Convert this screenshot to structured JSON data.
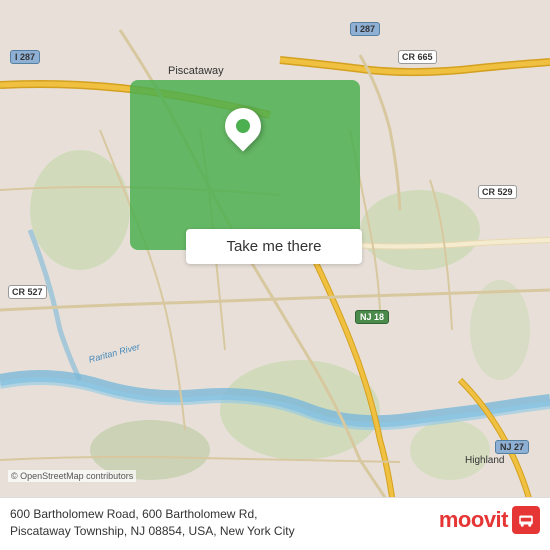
{
  "map": {
    "background_color": "#e8e0d8",
    "highlight_color": "#4CAF50"
  },
  "labels": {
    "highway_i287_top_left": "I 287",
    "highway_i287_top_right": "I 287",
    "highway_cr665": "CR 665",
    "highway_cr529": "CR 529",
    "highway_cr527": "CR 527",
    "highway_nj18": "NJ 18",
    "highway_nj27": "NJ 27",
    "place_piscataway": "Piscataway",
    "place_highland": "Highland",
    "place_new_york_city": "New York City",
    "river_raritan": "Raritan River"
  },
  "cta_button": {
    "label": "Take me there"
  },
  "address": {
    "line1": "600 Bartholomew Road, 600 Bartholomew Rd,",
    "line2": "Piscataway Township, NJ 08854, USA, New York City"
  },
  "osm_credit": "© OpenStreetMap contributors",
  "brand": {
    "name": "moovit"
  }
}
